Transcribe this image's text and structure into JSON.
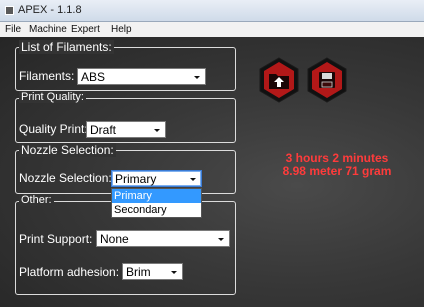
{
  "window": {
    "title": "APEX - 1.1.8"
  },
  "menu": [
    "File",
    "Machine",
    "Expert",
    "Help"
  ],
  "filaments": {
    "group_title": "List of Filaments:",
    "label": "Filaments:",
    "value": "ABS"
  },
  "print_quality": {
    "group_title": "Print Quality:",
    "label": "Quality Print:",
    "value": "Draft"
  },
  "nozzle": {
    "group_title": "Nozzle Selection:",
    "label": "Nozzle Selection:",
    "value": "Primary",
    "options": [
      "Primary",
      "Secondary"
    ]
  },
  "other": {
    "group_title": "Other:",
    "support_label": "Print Support:",
    "support_value": "None",
    "adhesion_label": "Platform adhesion:",
    "adhesion_value": "Brim"
  },
  "status": {
    "time": "3 hours 2 minutes",
    "material": "8.98 meter 71 gram"
  },
  "colors": {
    "accent_red": "#ff3b3b",
    "hex_button_red": "#b21818",
    "selection_blue": "#3399ff"
  },
  "icons": [
    "open-folder-icon",
    "save-icon",
    "chevron-down-icon"
  ]
}
